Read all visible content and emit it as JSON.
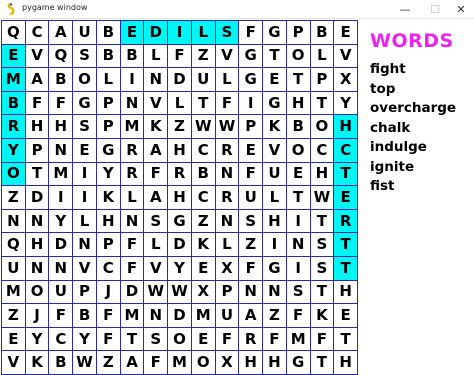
{
  "window": {
    "title": "pygame window",
    "icon": "pygame-snake-icon",
    "controls": {
      "minimize": "—",
      "maximize": "☐",
      "close": "✕"
    }
  },
  "grid": {
    "rows": [
      "QCAUBEDILSFGPBE",
      "EVQSBBLFZVGTOLV",
      "MABOLINDULGETPX",
      "BFFGPNVLTFIGHTY",
      "RHHSPMKZWWPKBOH",
      "YPNEGRAHCREVOCC",
      "OTMIYRFRBNFUEHT",
      "ZDIIKLAHCRULTWE",
      "NNYLHNSGZNSHITR",
      "QHDNPFLDKLZINST",
      "UNNVCFVYEXFGIST",
      "MOUPJDWWXPNNSTH",
      "ZJFBFMNDMUAZFKE",
      "EYCYFTSOEFRFMFT",
      "VKBWZAFMOXHHGTH"
    ],
    "highlighted": [
      [
        0,
        5
      ],
      [
        0,
        6
      ],
      [
        0,
        7
      ],
      [
        0,
        8
      ],
      [
        0,
        9
      ],
      [
        1,
        0
      ],
      [
        2,
        0
      ],
      [
        3,
        0
      ],
      [
        4,
        0
      ],
      [
        5,
        0
      ],
      [
        6,
        0
      ],
      [
        4,
        14
      ],
      [
        5,
        14
      ],
      [
        6,
        14
      ],
      [
        7,
        14
      ],
      [
        8,
        14
      ],
      [
        9,
        14
      ],
      [
        10,
        14
      ]
    ],
    "colors": {
      "highlight": "#00f5f5",
      "lines": "#2a2aa8",
      "text": "#000000"
    }
  },
  "panel": {
    "title": "WORDS",
    "title_color": "#ee22ee",
    "words": [
      "fight",
      "top",
      "overcharge",
      "chalk",
      "indulge",
      "ignite",
      "fist"
    ]
  }
}
